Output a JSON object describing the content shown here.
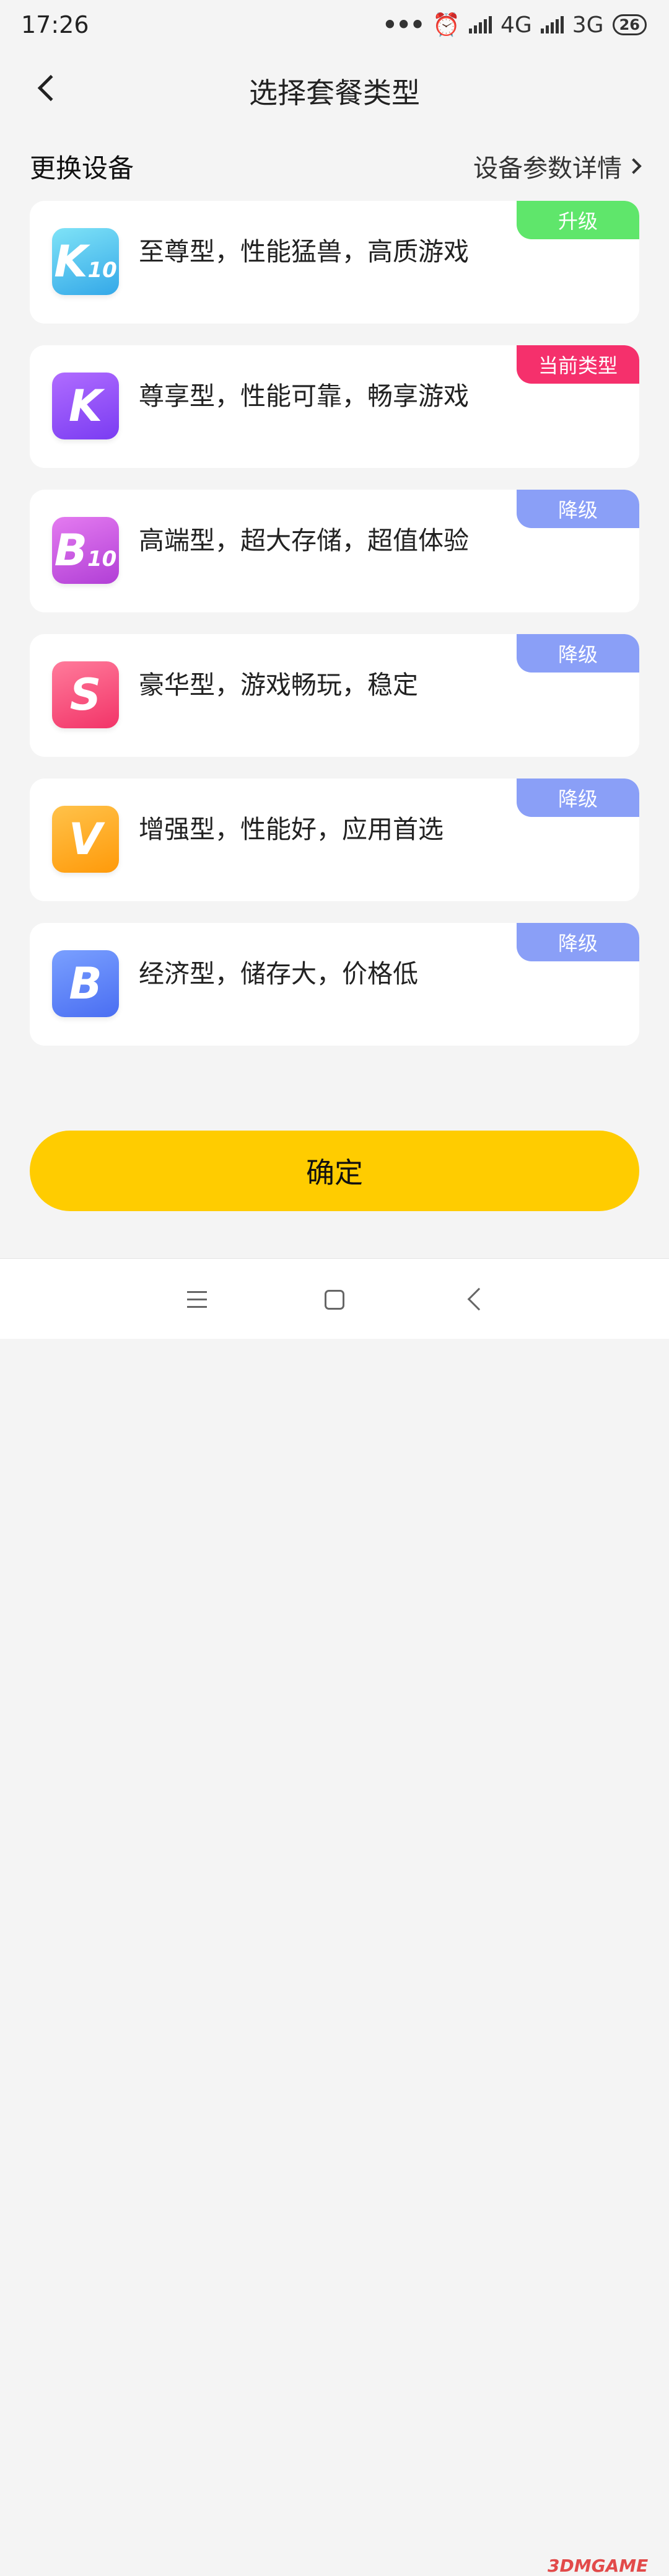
{
  "status_bar": {
    "time": "17:26",
    "dots": "•••",
    "alarm_icon": "alarm-icon",
    "network1": "4G",
    "network2": "3G",
    "battery": "26"
  },
  "header": {
    "title": "选择套餐类型",
    "back_icon": "back-chevron-icon"
  },
  "section": {
    "title": "更换设备",
    "detail_link": "设备参数详情"
  },
  "plans": [
    {
      "icon_letter": "K",
      "icon_sub": "10",
      "description": "至尊型，性能猛兽，高质游戏",
      "tag": "升级",
      "tag_color": "#5fe66b",
      "icon_gradient": [
        "#7fe3f7",
        "#34a8e8"
      ]
    },
    {
      "icon_letter": "K",
      "icon_sub": "",
      "description": "尊享型，性能可靠，畅享游戏",
      "tag": "当前类型",
      "tag_color": "#f5306c",
      "icon_gradient": [
        "#b06cff",
        "#7a3cf2"
      ]
    },
    {
      "icon_letter": "B",
      "icon_sub": "10",
      "description": "高端型，超大存储，超值体验",
      "tag": "降级",
      "tag_color": "#8a9ff7",
      "icon_gradient": [
        "#e47bf0",
        "#b13fd6"
      ]
    },
    {
      "icon_letter": "S",
      "icon_sub": "",
      "description": "豪华型，游戏畅玩，稳定",
      "tag": "降级",
      "tag_color": "#8a9ff7",
      "icon_gradient": [
        "#ff7b9b",
        "#f23468"
      ]
    },
    {
      "icon_letter": "V",
      "icon_sub": "",
      "description": "增强型，性能好，应用首选",
      "tag": "降级",
      "tag_color": "#8a9ff7",
      "icon_gradient": [
        "#ffc24a",
        "#ff9a0a"
      ]
    },
    {
      "icon_letter": "B",
      "icon_sub": "",
      "description": "经济型，储存大，价格低",
      "tag": "降级",
      "tag_color": "#8a9ff7",
      "icon_gradient": [
        "#7aa0ff",
        "#4a6ef2"
      ]
    }
  ],
  "confirm_label": "确定",
  "nav": {
    "menu_icon": "menu-icon",
    "home_icon": "home-icon",
    "back_icon": "back-icon"
  },
  "watermark": "3DMGAME"
}
